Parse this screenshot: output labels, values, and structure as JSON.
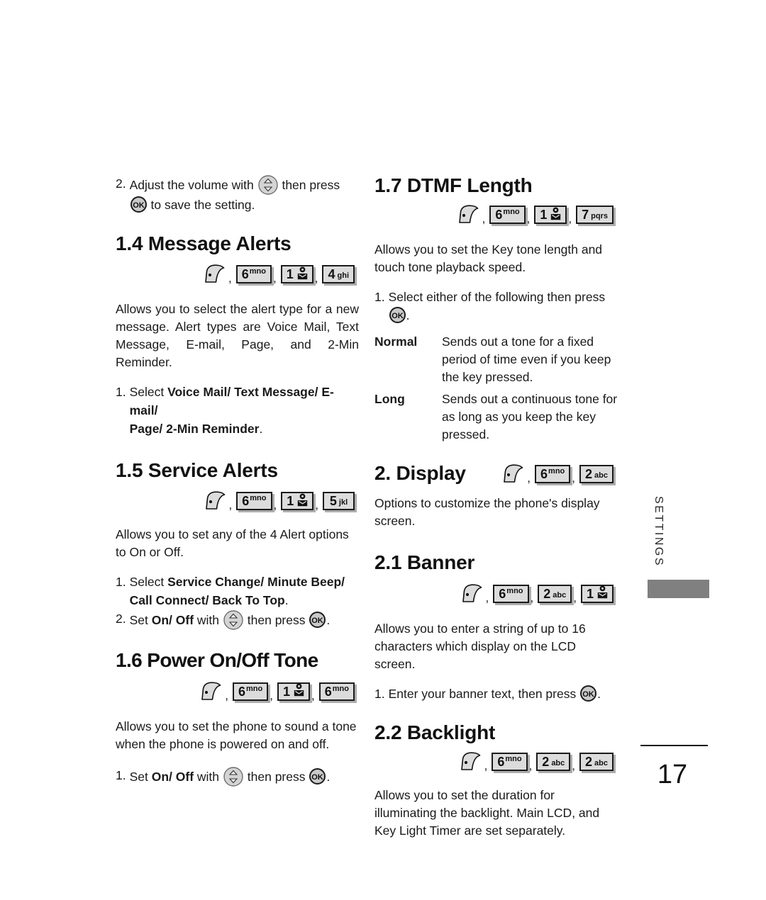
{
  "page": {
    "number": "17",
    "side_tab_label": "SETTINGS"
  },
  "left_column": {
    "step_continued": {
      "num": "2.",
      "text_before_nav": "Adjust the volume with",
      "text_between": "then press",
      "text_after_ok": "to save the setting."
    },
    "section_1_4": {
      "heading": "1.4 Message Alerts",
      "keys": [
        {
          "type": "menu",
          "name": "menu-key"
        },
        {
          "type": "key",
          "digit": "6",
          "sup": "mno"
        },
        {
          "type": "key",
          "digit": "1",
          "glyph": "mail"
        },
        {
          "type": "key",
          "digit": "4",
          "sub": "ghi"
        }
      ],
      "body": "Allows you to select the alert type for a new message. Alert types are Voice Mail, Text Message, E-mail, Page, and 2-Min Reminder.",
      "step_num": "1.",
      "step_lead": "Select ",
      "step_bold_line1": "Voice Mail/ Text Message/ E-mail/",
      "step_bold_line2": "Page/ 2-Min Reminder",
      "step_tail": "."
    },
    "section_1_5": {
      "heading": "1.5 Service Alerts",
      "keys": [
        {
          "type": "menu",
          "name": "menu-key"
        },
        {
          "type": "key",
          "digit": "6",
          "sup": "mno"
        },
        {
          "type": "key",
          "digit": "1",
          "glyph": "mail"
        },
        {
          "type": "key",
          "digit": "5",
          "sub": "jkl"
        }
      ],
      "body": "Allows you to set any of the 4 Alert options to On or Off.",
      "step1_num": "1.",
      "step1_lead": "Select ",
      "step1_bold_line1": "Service Change/ Minute Beep/",
      "step1_bold_line2": "Call Connect/ Back To Top",
      "step1_tail": ".",
      "step2_num": "2.",
      "step2_lead": "Set ",
      "step2_bold": "On/ Off",
      "step2_mid": " with",
      "step2_after_nav": "then press",
      "step2_tail": "."
    },
    "section_1_6": {
      "heading": "1.6 Power On/Off Tone",
      "keys": [
        {
          "type": "menu",
          "name": "menu-key"
        },
        {
          "type": "key",
          "digit": "6",
          "sup": "mno"
        },
        {
          "type": "key",
          "digit": "1",
          "glyph": "mail"
        },
        {
          "type": "key",
          "digit": "6",
          "sup": "mno"
        }
      ],
      "body": "Allows you to set the phone to sound a tone when the phone is powered on and off.",
      "step1_num": "1.",
      "step1_lead": "Set ",
      "step1_bold": "On/ Off",
      "step1_mid": " with",
      "step1_after_nav": "then press",
      "step1_tail": "."
    }
  },
  "right_column": {
    "section_1_7": {
      "heading": "1.7 DTMF Length",
      "keys": [
        {
          "type": "menu",
          "name": "menu-key"
        },
        {
          "type": "key",
          "digit": "6",
          "sup": "mno"
        },
        {
          "type": "key",
          "digit": "1",
          "glyph": "mail"
        },
        {
          "type": "key",
          "digit": "7",
          "sub": "pqrs"
        }
      ],
      "body": "Allows you to set the Key tone length and touch tone playback speed.",
      "step_num": "1.",
      "step_text": "Select either of the following then press",
      "step_tail": ".",
      "definitions": [
        {
          "term": "Normal",
          "desc": "Sends out a tone for a fixed period of time even if you keep the key pressed."
        },
        {
          "term": "Long",
          "desc": "Sends out a continuous tone for as long as you keep the key pressed."
        }
      ]
    },
    "section_2": {
      "heading": "2. Display",
      "keys": [
        {
          "type": "menu",
          "name": "menu-key"
        },
        {
          "type": "key",
          "digit": "6",
          "sup": "mno"
        },
        {
          "type": "key",
          "digit": "2",
          "sub": "abc"
        }
      ],
      "body": "Options to customize the phone's display screen."
    },
    "section_2_1": {
      "heading": "2.1 Banner",
      "keys": [
        {
          "type": "menu",
          "name": "menu-key"
        },
        {
          "type": "key",
          "digit": "6",
          "sup": "mno"
        },
        {
          "type": "key",
          "digit": "2",
          "sub": "abc"
        },
        {
          "type": "key",
          "digit": "1",
          "glyph": "mail"
        }
      ],
      "body": "Allows you to enter a string of up to 16 characters which display on the LCD screen.",
      "step_num": "1.",
      "step_text": "Enter your banner text, then press",
      "step_tail": "."
    },
    "section_2_2": {
      "heading": "2.2 Backlight",
      "keys": [
        {
          "type": "menu",
          "name": "menu-key"
        },
        {
          "type": "key",
          "digit": "6",
          "sup": "mno"
        },
        {
          "type": "key",
          "digit": "2",
          "sub": "abc"
        },
        {
          "type": "key",
          "digit": "2",
          "sub": "abc"
        }
      ],
      "body": "Allows you to set the duration for illuminating the backlight. Main LCD, and Key Light Timer are set separately."
    }
  },
  "colors": {
    "key_fill": "#dcdcdc",
    "key_border": "#1b1b1b",
    "tab_bar": "#808080",
    "text": "#1a1a1a"
  }
}
